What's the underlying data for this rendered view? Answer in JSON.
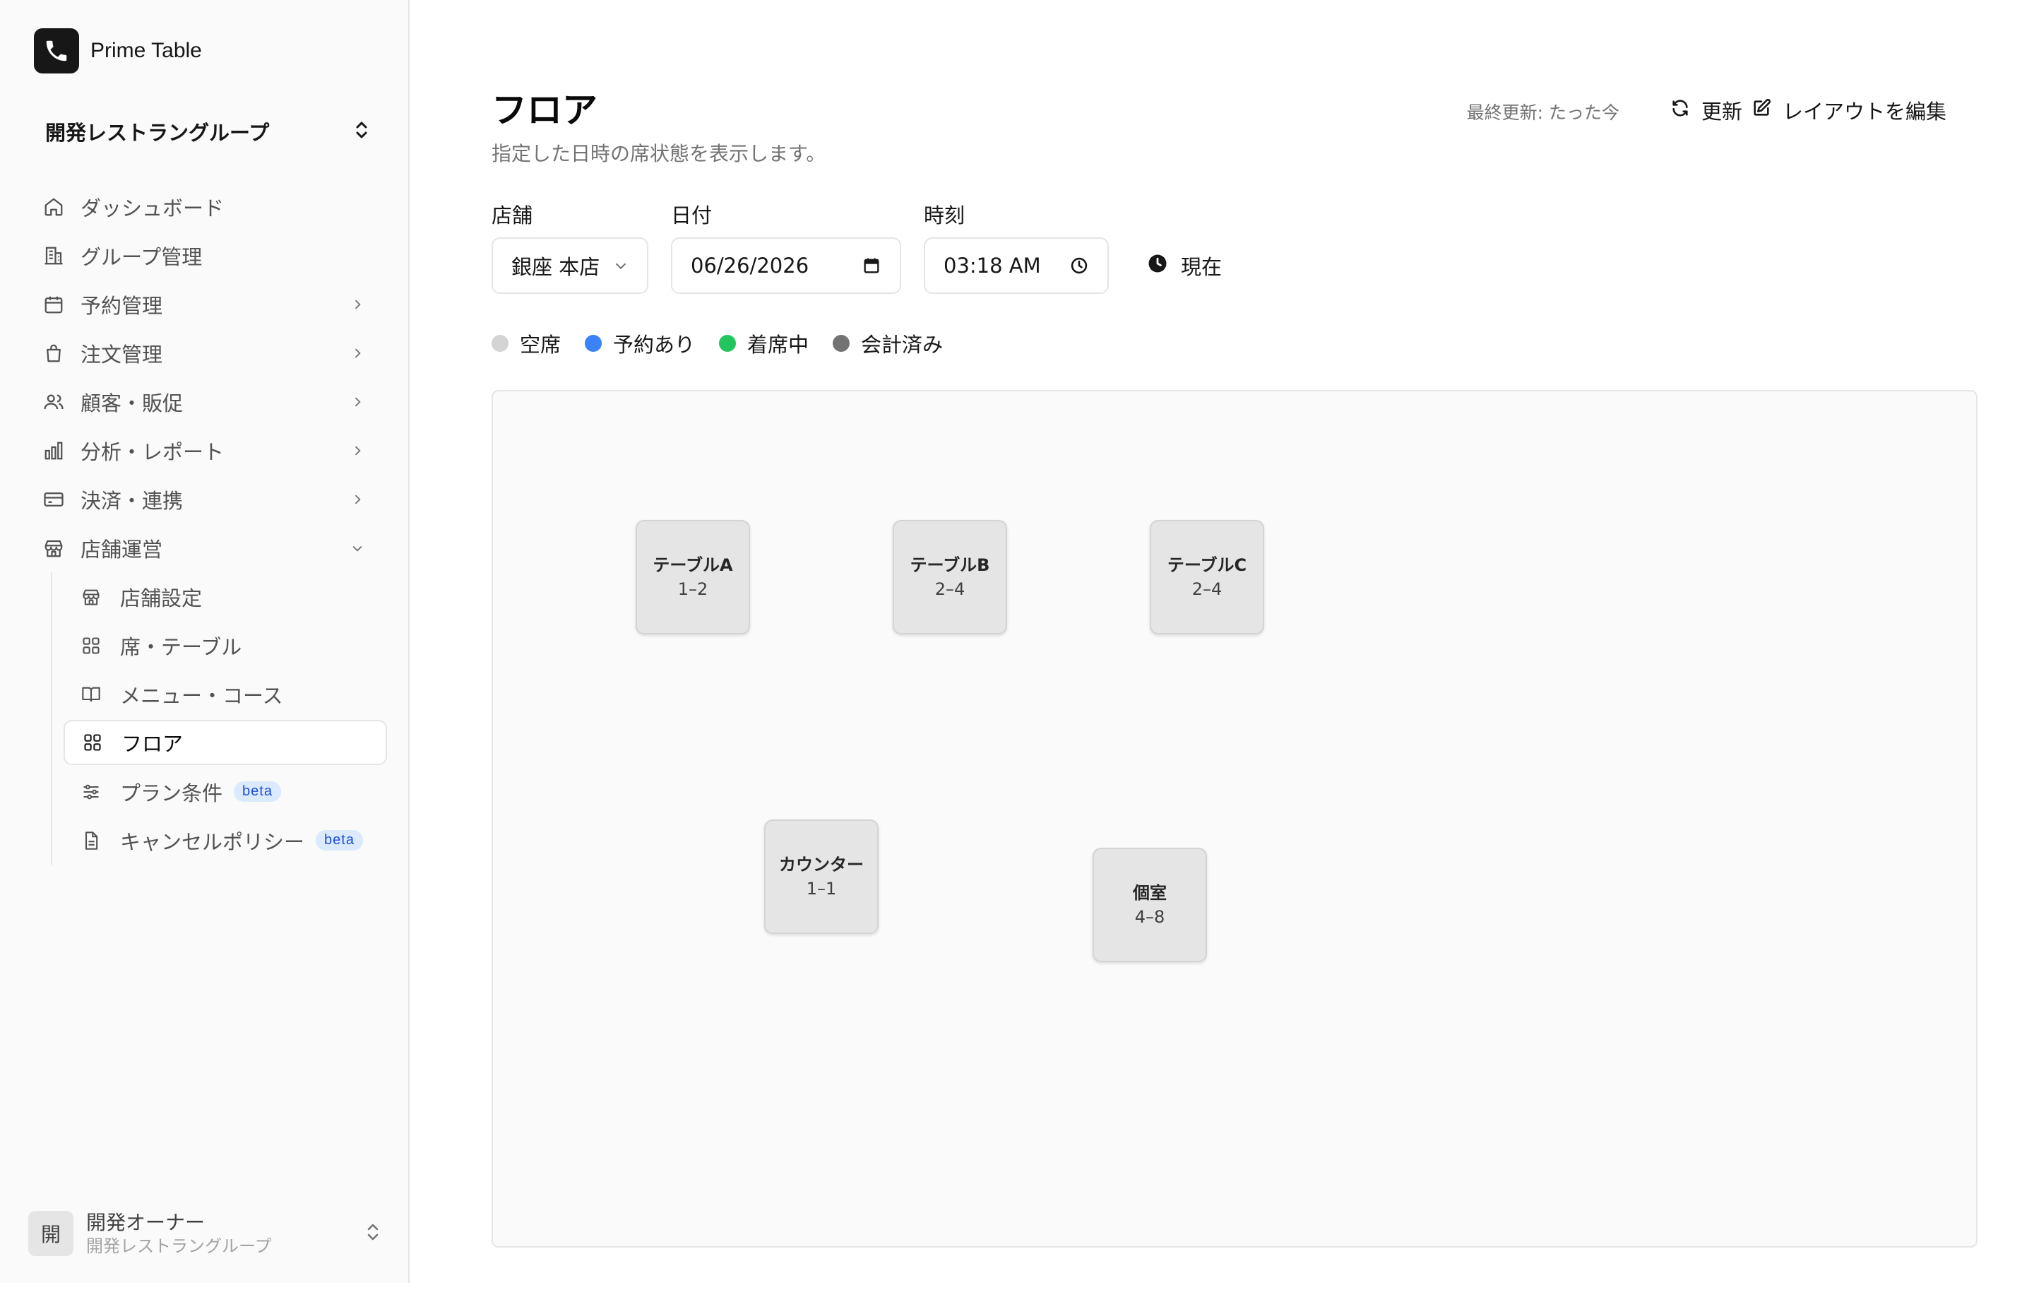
{
  "brand": {
    "name": "Prime Table"
  },
  "group_switch": {
    "label": "開発レストラングループ"
  },
  "nav": [
    {
      "label": "ダッシュボード",
      "icon": "home-icon",
      "chevron": ""
    },
    {
      "label": "グループ管理",
      "icon": "building-icon",
      "chevron": ""
    },
    {
      "label": "予約管理",
      "icon": "calendar-icon",
      "chevron": "right"
    },
    {
      "label": "注文管理",
      "icon": "shopping-bag-icon",
      "chevron": "right"
    },
    {
      "label": "顧客・販促",
      "icon": "users-icon",
      "chevron": "right"
    },
    {
      "label": "分析・レポート",
      "icon": "bar-chart-icon",
      "chevron": "right"
    },
    {
      "label": "決済・連携",
      "icon": "credit-card-icon",
      "chevron": "right"
    },
    {
      "label": "店舗運営",
      "icon": "store-icon",
      "chevron": "down"
    }
  ],
  "subnav": [
    {
      "label": "店舗設定",
      "icon": "store-icon",
      "badge": ""
    },
    {
      "label": "席・テーブル",
      "icon": "grid-icon",
      "badge": ""
    },
    {
      "label": "メニュー・コース",
      "icon": "book-icon",
      "badge": ""
    },
    {
      "label": "フロア",
      "icon": "grid-icon",
      "badge": "",
      "active": true
    },
    {
      "label": "プラン条件",
      "icon": "sliders-icon",
      "badge": "beta"
    },
    {
      "label": "キャンセルポリシー",
      "icon": "file-icon",
      "badge": "beta"
    }
  ],
  "user": {
    "avatar_initial": "開",
    "name": "開発オーナー",
    "group": "開発レストラングループ"
  },
  "header": {
    "title": "フロア",
    "subtitle": "指定した日時の席状態を表示します。",
    "last_update": "最終更新: たった今",
    "refresh_label": "更新",
    "edit_layout_label": "レイアウトを編集"
  },
  "filters": {
    "store_label": "店舗",
    "store_value": "銀座 本店",
    "date_label": "日付",
    "date_value": "06/26/2026",
    "time_label": "時刻",
    "time_value": "03:18 AM",
    "now_label": "現在"
  },
  "legend": [
    {
      "label": "空席",
      "color": "#d4d4d4"
    },
    {
      "label": "予約あり",
      "color": "#3b82f6"
    },
    {
      "label": "着席中",
      "color": "#22c55e"
    },
    {
      "label": "会計済み",
      "color": "#737373"
    }
  ],
  "tables": [
    {
      "name": "テーブルA",
      "capacity": "1–2"
    },
    {
      "name": "テーブルB",
      "capacity": "2–4"
    },
    {
      "name": "テーブルC",
      "capacity": "2–4"
    },
    {
      "name": "カウンター",
      "capacity": "1–1"
    },
    {
      "name": "個室",
      "capacity": "4–8"
    }
  ]
}
